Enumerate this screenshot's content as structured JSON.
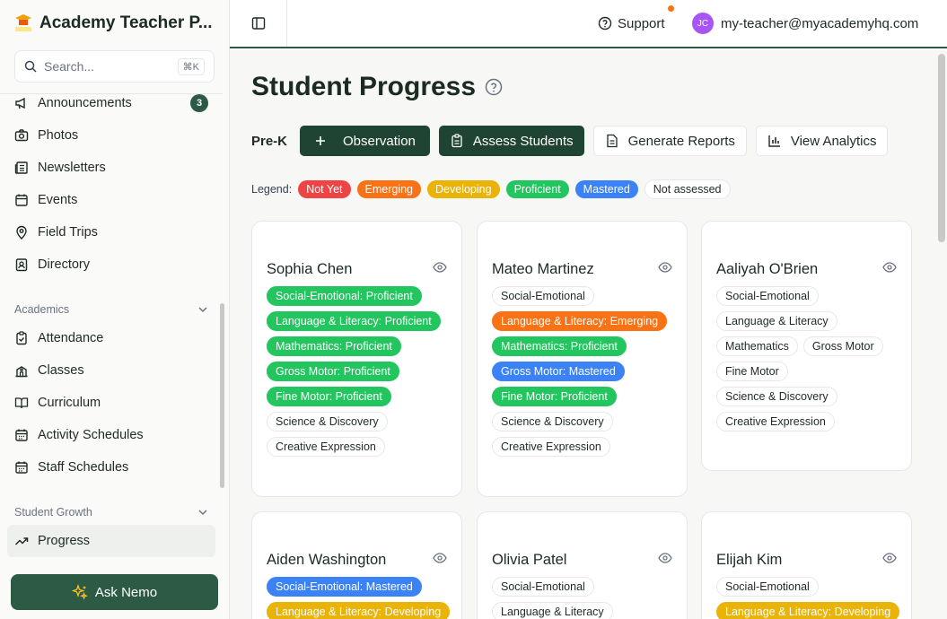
{
  "brand": {
    "title": "Academy Teacher P..."
  },
  "search": {
    "placeholder": "Search...",
    "shortcut": "⌘K"
  },
  "nav": {
    "items_top": [
      {
        "label": "Announcements",
        "icon": "megaphone-icon",
        "badge": "3"
      },
      {
        "label": "Photos",
        "icon": "camera-icon"
      },
      {
        "label": "Newsletters",
        "icon": "newspaper-icon"
      },
      {
        "label": "Events",
        "icon": "calendar-icon"
      },
      {
        "label": "Field Trips",
        "icon": "map-pin-icon"
      },
      {
        "label": "Directory",
        "icon": "contact-icon"
      }
    ],
    "academics_label": "Academics",
    "academics": [
      {
        "label": "Attendance",
        "icon": "clipboard-check-icon"
      },
      {
        "label": "Classes",
        "icon": "school-icon"
      },
      {
        "label": "Curriculum",
        "icon": "book-icon"
      },
      {
        "label": "Activity Schedules",
        "icon": "calendar-icon"
      },
      {
        "label": "Staff Schedules",
        "icon": "calendar-icon"
      }
    ],
    "growth_label": "Student Growth",
    "growth": [
      {
        "label": "Progress",
        "icon": "trending-up-icon"
      }
    ]
  },
  "ask_button": "Ask Nemo",
  "topbar": {
    "support": "Support",
    "avatar_initials": "JC",
    "email": "my-teacher@myacademyhq.com"
  },
  "page": {
    "title": "Student Progress"
  },
  "toolbar": {
    "grade": "Pre-K",
    "observation": "Observation",
    "assess": "Assess Students",
    "reports": "Generate Reports",
    "analytics": "View Analytics"
  },
  "legend": {
    "label": "Legend:",
    "items": [
      {
        "label": "Not Yet",
        "color": "#ef4444",
        "text": "#ffffff"
      },
      {
        "label": "Emerging",
        "color": "#f97316",
        "text": "#ffffff"
      },
      {
        "label": "Developing",
        "color": "#eab308",
        "text": "#ffffff"
      },
      {
        "label": "Proficient",
        "color": "#22c55e",
        "text": "#ffffff"
      },
      {
        "label": "Mastered",
        "color": "#3b82f6",
        "text": "#ffffff"
      },
      {
        "label": "Not assessed",
        "color": "#ffffff",
        "text": "#1f2a24"
      }
    ]
  },
  "students": [
    {
      "name": "Sophia Chen",
      "tags": [
        {
          "text": "Social-Emotional: Proficient",
          "level": "proficient"
        },
        {
          "text": "Language & Literacy: Proficient",
          "level": "proficient"
        },
        {
          "text": "Mathematics: Proficient",
          "level": "proficient"
        },
        {
          "text": "Gross Motor: Proficient",
          "level": "proficient"
        },
        {
          "text": "Fine Motor: Proficient",
          "level": "proficient"
        },
        {
          "text": "Science & Discovery",
          "level": "none"
        },
        {
          "text": "Creative Expression",
          "level": "none"
        }
      ]
    },
    {
      "name": "Mateo Martinez",
      "tags": [
        {
          "text": "Social-Emotional",
          "level": "none"
        },
        {
          "text": "Language & Literacy: Emerging",
          "level": "emerging"
        },
        {
          "text": "Mathematics: Proficient",
          "level": "proficient"
        },
        {
          "text": "Gross Motor: Mastered",
          "level": "mastered"
        },
        {
          "text": "Fine Motor: Proficient",
          "level": "proficient"
        },
        {
          "text": "Science & Discovery",
          "level": "none"
        },
        {
          "text": "Creative Expression",
          "level": "none"
        }
      ]
    },
    {
      "name": "Aaliyah O'Brien",
      "tags": [
        {
          "text": "Social-Emotional",
          "level": "none"
        },
        {
          "text": "Language & Literacy",
          "level": "none"
        },
        {
          "text": "Mathematics",
          "level": "none"
        },
        {
          "text": "Gross Motor",
          "level": "none"
        },
        {
          "text": "Fine Motor",
          "level": "none"
        },
        {
          "text": "Science & Discovery",
          "level": "none"
        },
        {
          "text": "Creative Expression",
          "level": "none"
        }
      ]
    },
    {
      "name": "Aiden Washington",
      "tags": [
        {
          "text": "Social-Emotional: Mastered",
          "level": "mastered"
        },
        {
          "text": "Language & Literacy: Developing",
          "level": "developing"
        }
      ]
    },
    {
      "name": "Olivia Patel",
      "tags": [
        {
          "text": "Social-Emotional",
          "level": "none"
        },
        {
          "text": "Language & Literacy",
          "level": "none"
        }
      ]
    },
    {
      "name": "Elijah Kim",
      "tags": [
        {
          "text": "Social-Emotional",
          "level": "none"
        },
        {
          "text": "Language & Literacy: Developing",
          "level": "developing"
        }
      ]
    }
  ]
}
